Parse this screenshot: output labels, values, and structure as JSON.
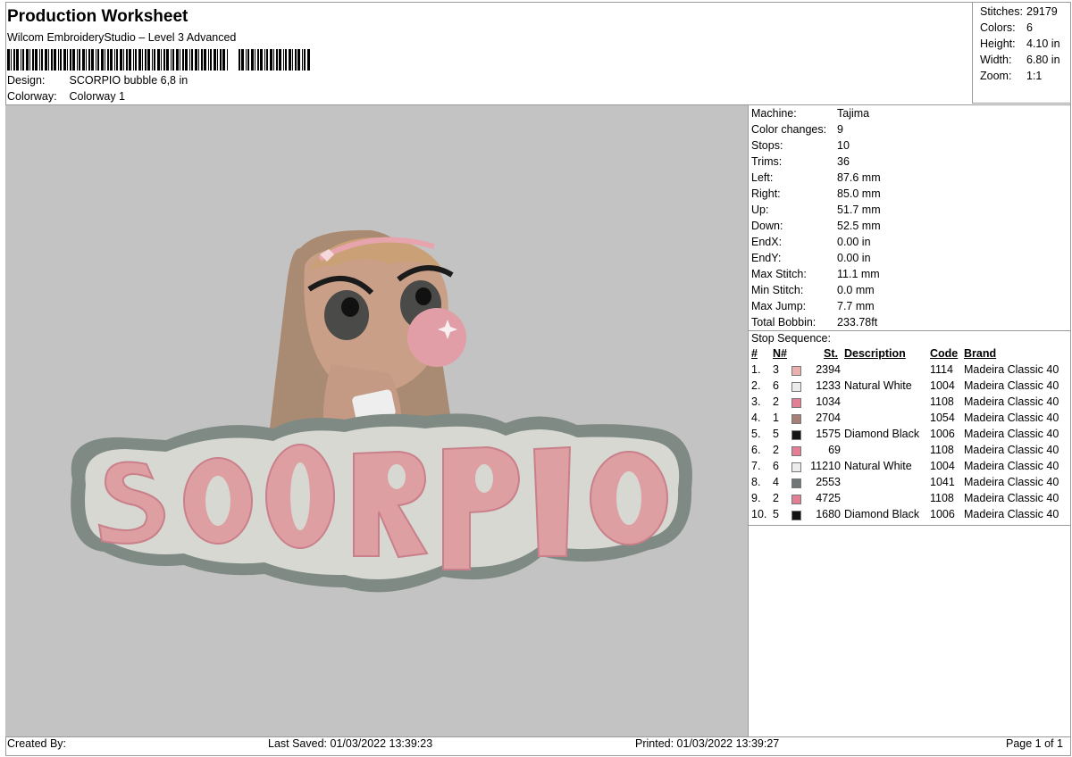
{
  "header": {
    "title": "Production Worksheet",
    "subtitle": "Wilcom EmbroideryStudio – Level 3 Advanced",
    "design_label": "Design:",
    "design_value": "SCORPIO bubble 6,8 in",
    "colorway_label": "Colorway:",
    "colorway_value": "Colorway 1"
  },
  "stats": {
    "stitches_label": "Stitches:",
    "stitches": "29179",
    "colors_label": "Colors:",
    "colors": "6",
    "height_label": "Height:",
    "height": "4.10 in",
    "width_label": "Width:",
    "width": "6.80 in",
    "zoom_label": "Zoom:",
    "zoom": "1:1"
  },
  "machine_info": [
    {
      "label": "Machine:",
      "value": "Tajima"
    },
    {
      "label": "Color changes:",
      "value": "9"
    },
    {
      "label": "Stops:",
      "value": "10"
    },
    {
      "label": "Trims:",
      "value": "36"
    },
    {
      "label": "Left:",
      "value": "87.6 mm"
    },
    {
      "label": "Right:",
      "value": "85.0 mm"
    },
    {
      "label": "Up:",
      "value": "51.7 mm"
    },
    {
      "label": "Down:",
      "value": "52.5 mm"
    },
    {
      "label": "EndX:",
      "value": "0.00 in"
    },
    {
      "label": "EndY:",
      "value": "0.00 in"
    },
    {
      "label": "Max Stitch:",
      "value": "11.1 mm"
    },
    {
      "label": "Min Stitch:",
      "value": "0.0 mm"
    },
    {
      "label": "Max Jump:",
      "value": "7.7 mm"
    },
    {
      "label": "Total Bobbin:",
      "value": "233.78ft"
    }
  ],
  "stop_sequence": {
    "title": "Stop Sequence:",
    "headers": {
      "num": "#",
      "n": "N#",
      "st": "St.",
      "desc": "Description",
      "code": "Code",
      "brand": "Brand"
    },
    "rows": [
      {
        "num": "1.",
        "n": "3",
        "color": "#e9b0ae",
        "st": "2394",
        "desc": "",
        "code": "1114",
        "brand": "Madeira Classic 40"
      },
      {
        "num": "2.",
        "n": "6",
        "color": "#ececec",
        "st": "1233",
        "desc": "Natural White",
        "code": "1004",
        "brand": "Madeira Classic 40"
      },
      {
        "num": "3.",
        "n": "2",
        "color": "#e27f94",
        "st": "1034",
        "desc": "",
        "code": "1108",
        "brand": "Madeira Classic 40"
      },
      {
        "num": "4.",
        "n": "1",
        "color": "#a67f76",
        "st": "2704",
        "desc": "",
        "code": "1054",
        "brand": "Madeira Classic 40"
      },
      {
        "num": "5.",
        "n": "5",
        "color": "#141414",
        "st": "1575",
        "desc": "Diamond Black",
        "code": "1006",
        "brand": "Madeira Classic 40"
      },
      {
        "num": "6.",
        "n": "2",
        "color": "#e27f94",
        "st": "69",
        "desc": "",
        "code": "1108",
        "brand": "Madeira Classic 40"
      },
      {
        "num": "7.",
        "n": "6",
        "color": "#ececec",
        "st": "11210",
        "desc": "Natural White",
        "code": "1004",
        "brand": "Madeira Classic 40"
      },
      {
        "num": "8.",
        "n": "4",
        "color": "#6f7675",
        "st": "2553",
        "desc": "",
        "code": "1041",
        "brand": "Madeira Classic 40"
      },
      {
        "num": "9.",
        "n": "2",
        "color": "#e27f94",
        "st": "4725",
        "desc": "",
        "code": "1108",
        "brand": "Madeira Classic 40"
      },
      {
        "num": "10.",
        "n": "5",
        "color": "#141414",
        "st": "1680",
        "desc": "Diamond Black",
        "code": "1006",
        "brand": "Madeira Classic 40"
      }
    ]
  },
  "design_preview": {
    "letters": "SCORPIO",
    "icon": "girl-blowing-bubble-illustration"
  },
  "footer": {
    "created_by": "Created By:",
    "last_saved": "Last Saved: 01/03/2022 13:39:23",
    "printed": "Printed: 01/03/2022 13:39:27",
    "page": "Page 1 of 1"
  }
}
